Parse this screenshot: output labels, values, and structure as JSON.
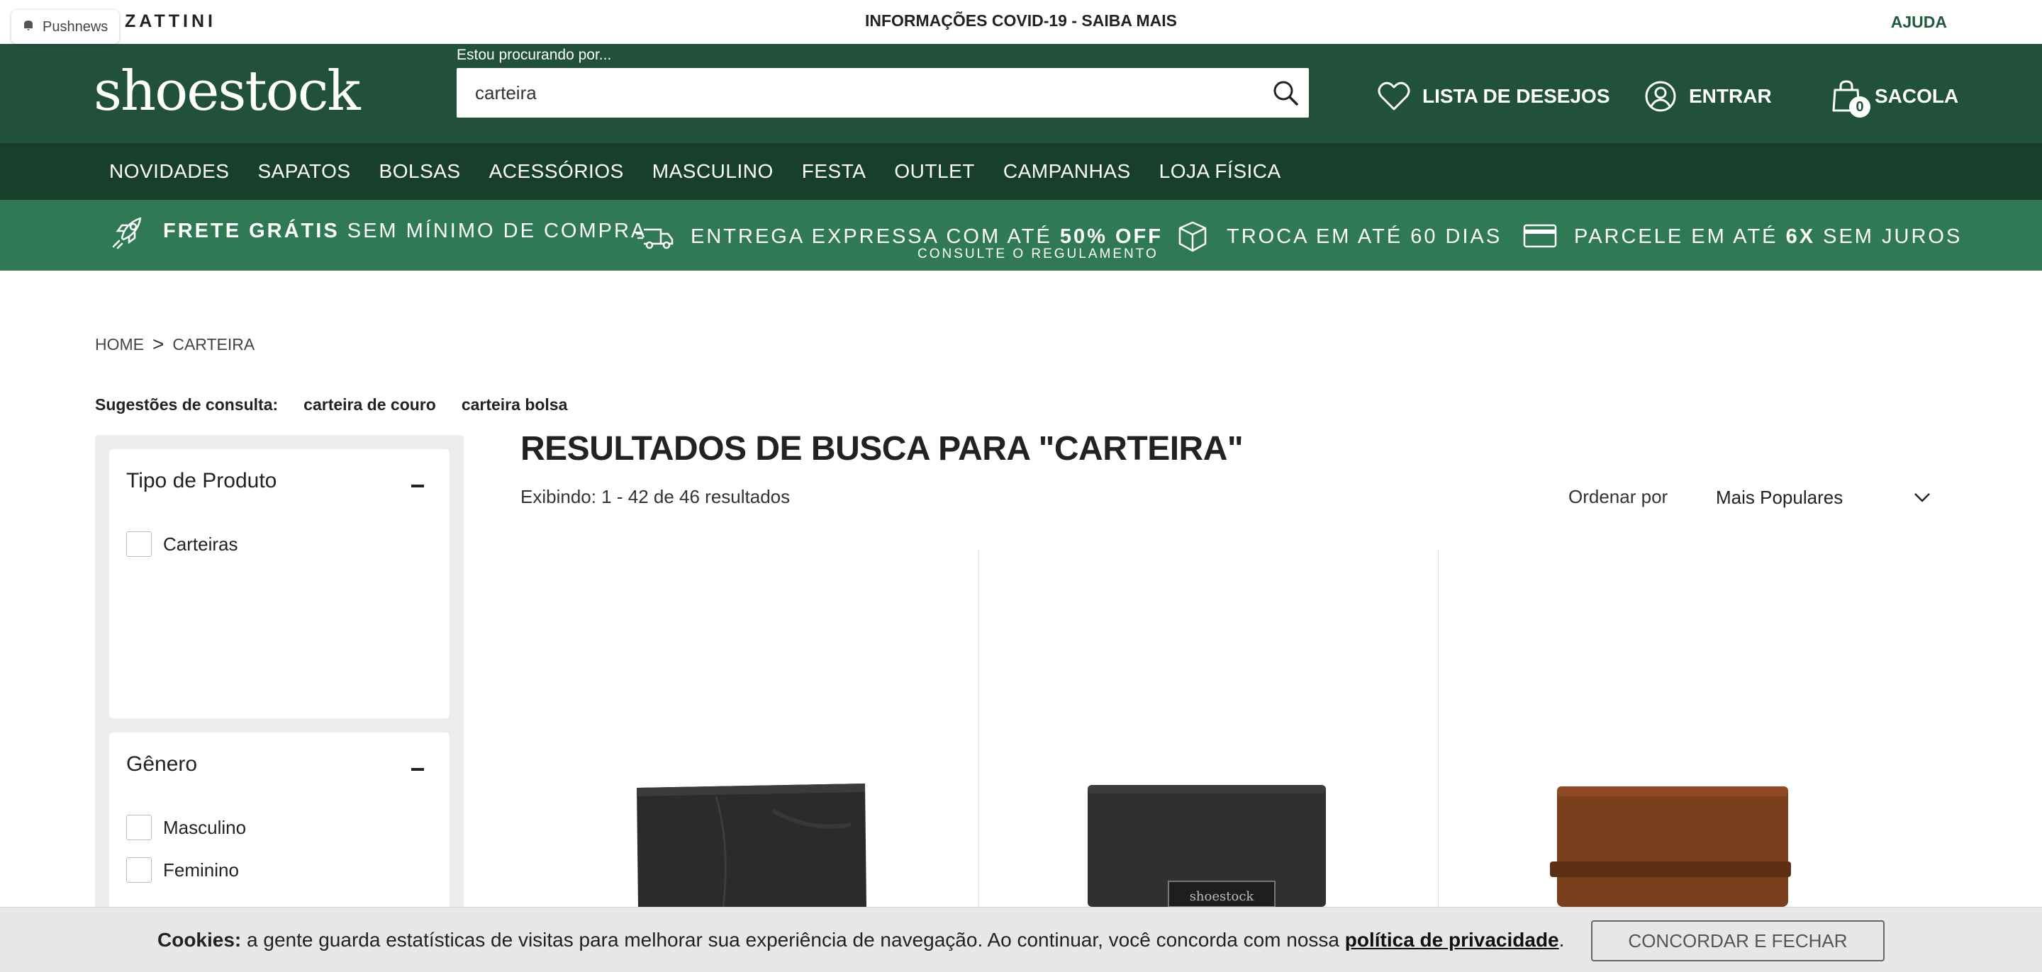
{
  "pushnews": {
    "label": "Pushnews",
    "icon": "bell-icon"
  },
  "topbar": {
    "partner": "ZATTINI",
    "announcement": "INFORMAÇÕES COVID-19 - SAIBA MAIS",
    "help": "AJUDA"
  },
  "header": {
    "logo": "shoestock",
    "search": {
      "label": "Estou procurando por...",
      "value": "carteira",
      "icon": "search-icon"
    },
    "wishlist": {
      "label": "LISTA DE DESEJOS",
      "icon": "heart-icon"
    },
    "login": {
      "label": "ENTRAR",
      "icon": "user-icon"
    },
    "bag": {
      "label": "SACOLA",
      "count": "0",
      "icon": "bag-icon"
    }
  },
  "nav": {
    "items": [
      "NOVIDADES",
      "SAPATOS",
      "BOLSAS",
      "ACESSÓRIOS",
      "MASCULINO",
      "FESTA",
      "OUTLET",
      "CAMPANHAS",
      "LOJA FÍSICA"
    ]
  },
  "promo": {
    "free_shipping_bold": "FRETE GRÁTIS",
    "free_shipping_rest": "SEM MÍNIMO DE COMPRA",
    "express_pre": "ENTREGA EXPRESSA COM ATÉ",
    "express_bold": "50% OFF",
    "express_sub": "CONSULTE O REGULAMENTO",
    "exchange": "TROCA EM ATÉ 60 DIAS",
    "installments_pre": "PARCELE EM ATÉ",
    "installments_bold": "6X",
    "installments_post": "SEM JUROS",
    "icons": [
      "rocket-icon",
      "truck-icon",
      "box-icon",
      "card-icon"
    ]
  },
  "breadcrumb": {
    "home": "HOME",
    "separator": ">",
    "current": "CARTEIRA"
  },
  "suggestions": {
    "label": "Sugestões de consulta:",
    "items": [
      "carteira de couro",
      "carteira bolsa"
    ]
  },
  "filters": [
    {
      "title": "Tipo de Produto",
      "options": [
        "Carteiras"
      ]
    },
    {
      "title": "Gênero",
      "options": [
        "Masculino",
        "Feminino"
      ]
    }
  ],
  "results": {
    "title": "RESULTADOS DE BUSCA PARA \"CARTEIRA\"",
    "count": "Exibindo: 1 - 42 de 46 resultados",
    "sort_label": "Ordenar por",
    "sort_value": "Mais Populares"
  },
  "products": [
    {
      "image": "black-wallet-image",
      "color": "#2b2b2b"
    },
    {
      "image": "black-textured-wallet-image",
      "color": "#303030",
      "brand_mark": "shoestock"
    },
    {
      "image": "brown-leather-wallet-image",
      "color": "#7a3f1c"
    }
  ],
  "cookie": {
    "bold": "Cookies:",
    "text": "a gente guarda estatísticas de visitas para melhorar sua experiência de navegação. Ao continuar, você concorda com nossa",
    "link": "política de privacidade",
    "end": ".",
    "button": "CONCORDAR E FECHAR"
  },
  "colors": {
    "header": "#21513a",
    "nav": "#173f2c",
    "promo": "#2f7a55"
  }
}
